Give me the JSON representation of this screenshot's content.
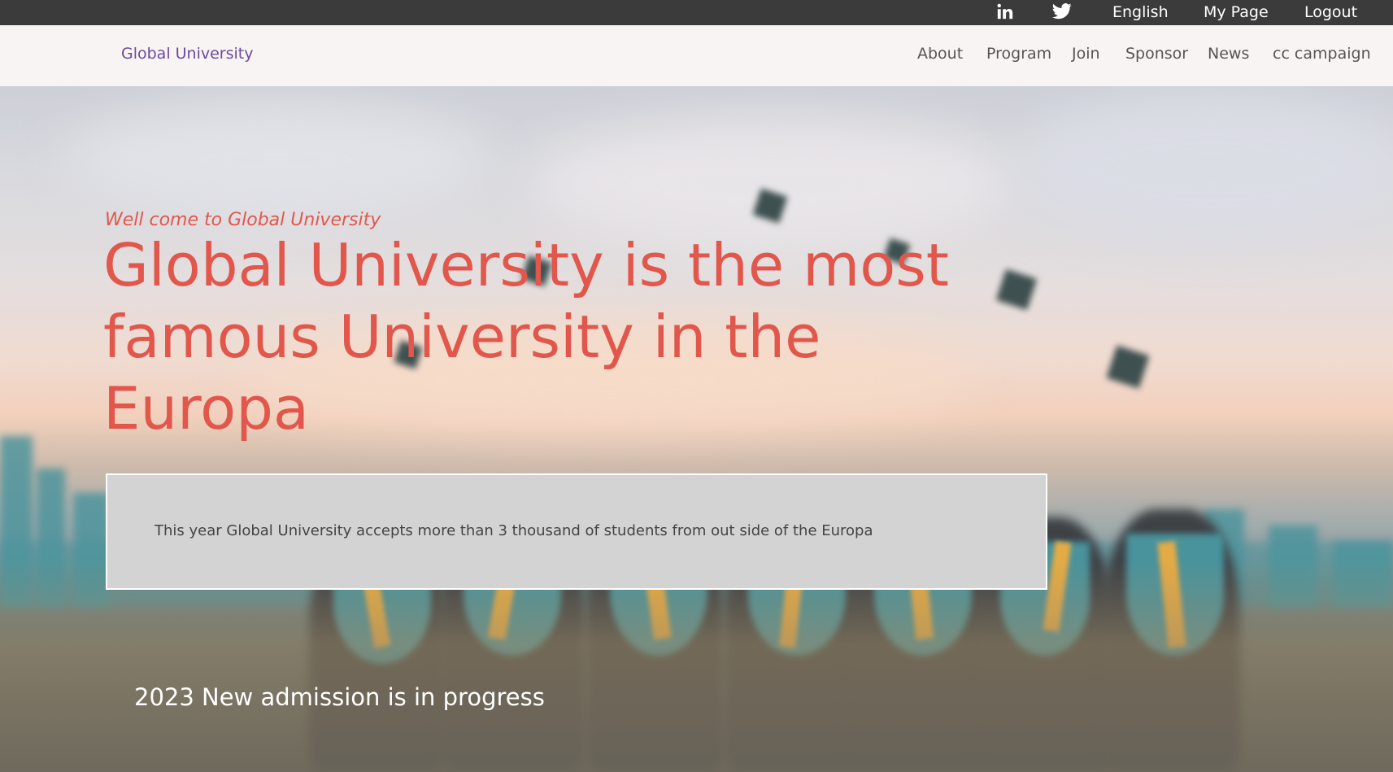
{
  "topbar": {
    "icons": [
      "linkedin-icon",
      "twitter-icon"
    ],
    "language": "English",
    "my_page": "My Page",
    "logout": "Logout"
  },
  "nav": {
    "brand": "Global University",
    "links": [
      "About",
      "Program",
      "Join",
      "Sponsor",
      "News",
      "cc campaign"
    ]
  },
  "hero": {
    "welcome": "Well come to Global University",
    "headline": "Global University is the most famous University in the Europa",
    "notice": "This year Global University accepts more than 3 thousand of students from out side of the Europa",
    "admission": "2023 New admission is in progress"
  },
  "colors": {
    "accent": "#e2574c",
    "brand": "#6d4a9a",
    "topbar_bg": "#3b3b3b",
    "nav_bg": "#f7f4f3",
    "notice_bg": "#d3d3d3"
  }
}
